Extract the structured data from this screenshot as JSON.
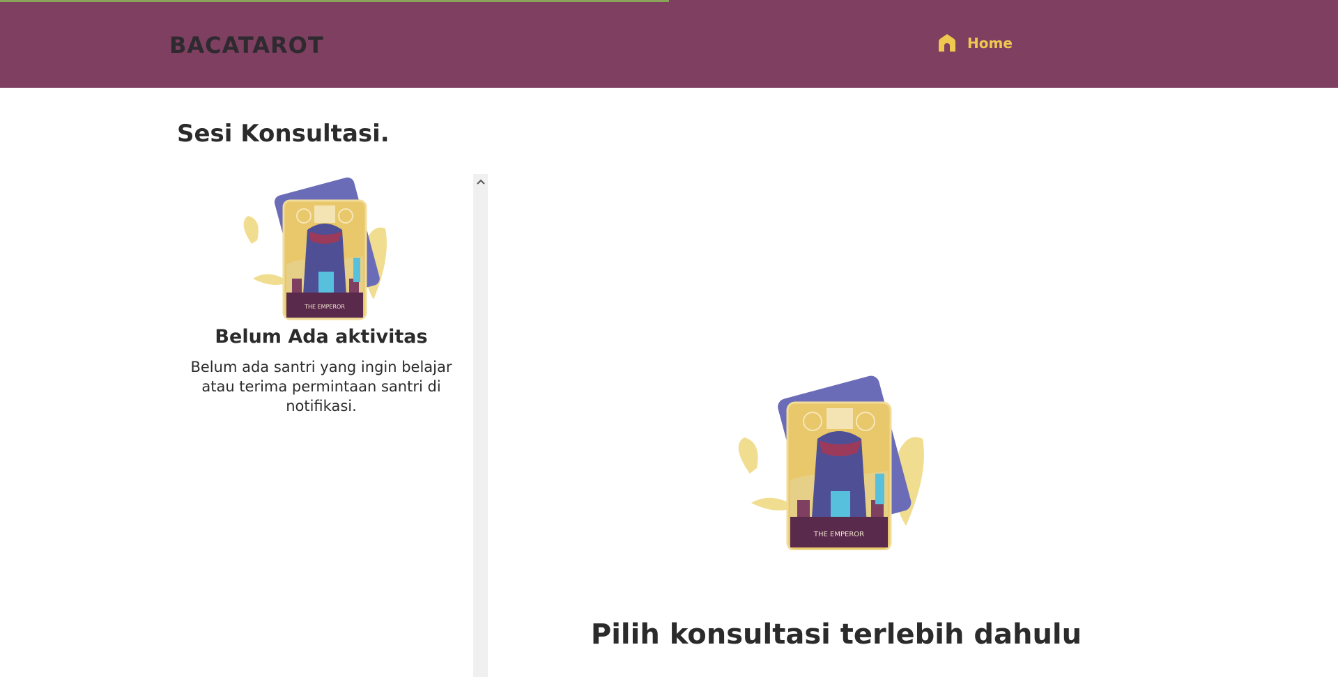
{
  "header": {
    "brand": "BACATAROT",
    "nav": {
      "home_label": "Home"
    },
    "page_load_progress": 0.5,
    "colors": {
      "background": "#7e3f61",
      "nav_accent": "#f1c84f",
      "progress": "#8aa35a"
    }
  },
  "page": {
    "title": "Sesi Konsultasi."
  },
  "session_list": {
    "empty_title": "Belum Ada aktivitas",
    "empty_description": "Belum ada santri yang ingin belajar atau terima permintaan santri di notifikasi.",
    "illustration_card_label": "THE EMPEROR",
    "scroll_up_icon": "chevron-up-icon"
  },
  "detail": {
    "illustration_card_label": "THE EMPEROR",
    "prompt": "Pilih konsultasi terlebih dahulu"
  }
}
